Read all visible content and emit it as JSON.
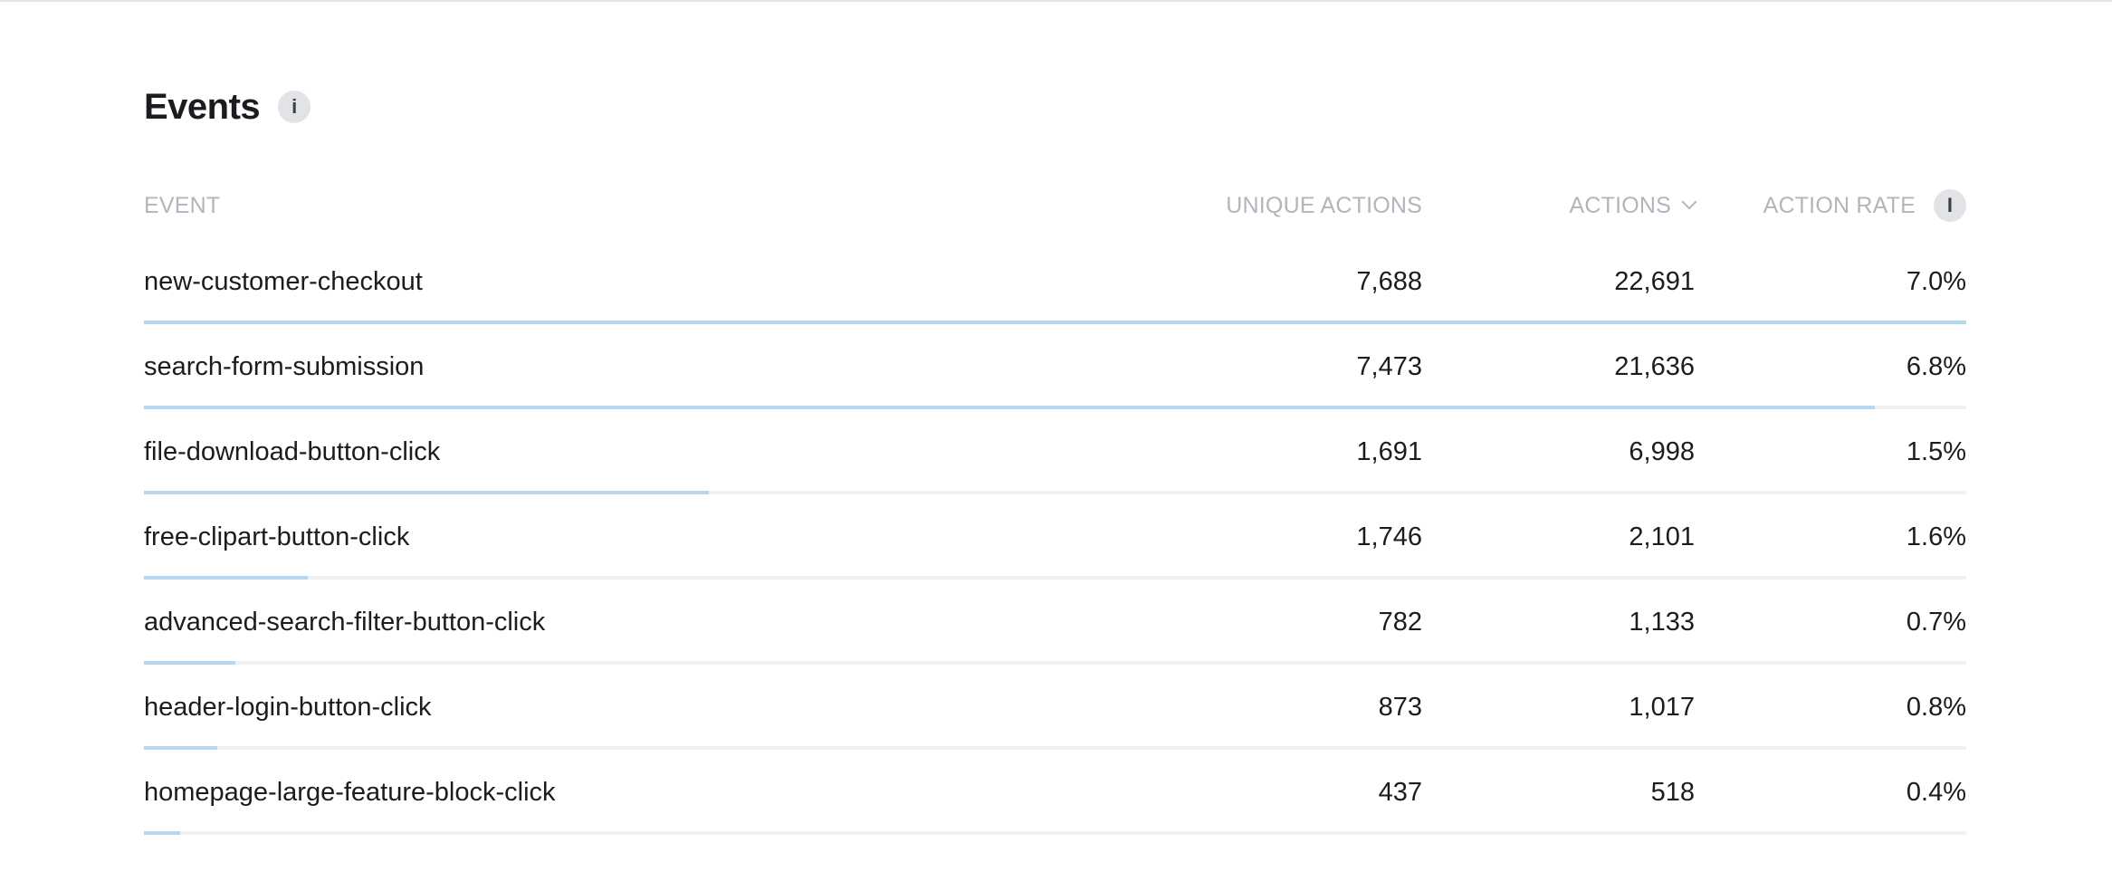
{
  "panel": {
    "title": "Events",
    "info_icon": "info-icon"
  },
  "table": {
    "columns": {
      "event": "EVENT",
      "unique_actions": "UNIQUE ACTIONS",
      "actions": "ACTIONS",
      "action_rate": "ACTION RATE"
    },
    "sort_icon": "chevron-down-icon",
    "bar_color": "#b4d6ee",
    "rows": [
      {
        "event": "new-customer-checkout",
        "unique_actions": "7,688",
        "actions": "22,691",
        "action_rate": "7.0%",
        "bar_fraction": 1.0
      },
      {
        "event": "search-form-submission",
        "unique_actions": "7,473",
        "actions": "21,636",
        "action_rate": "6.8%",
        "bar_fraction": 0.95
      },
      {
        "event": "file-download-button-click",
        "unique_actions": "1,691",
        "actions": "6,998",
        "action_rate": "1.5%",
        "bar_fraction": 0.31
      },
      {
        "event": "free-clipart-button-click",
        "unique_actions": "1,746",
        "actions": "2,101",
        "action_rate": "1.6%",
        "bar_fraction": 0.09
      },
      {
        "event": "advanced-search-filter-button-click",
        "unique_actions": "782",
        "actions": "1,133",
        "action_rate": "0.7%",
        "bar_fraction": 0.05
      },
      {
        "event": "header-login-button-click",
        "unique_actions": "873",
        "actions": "1,017",
        "action_rate": "0.8%",
        "bar_fraction": 0.04
      },
      {
        "event": "homepage-large-feature-block-click",
        "unique_actions": "437",
        "actions": "518",
        "action_rate": "0.4%",
        "bar_fraction": 0.02
      }
    ]
  }
}
